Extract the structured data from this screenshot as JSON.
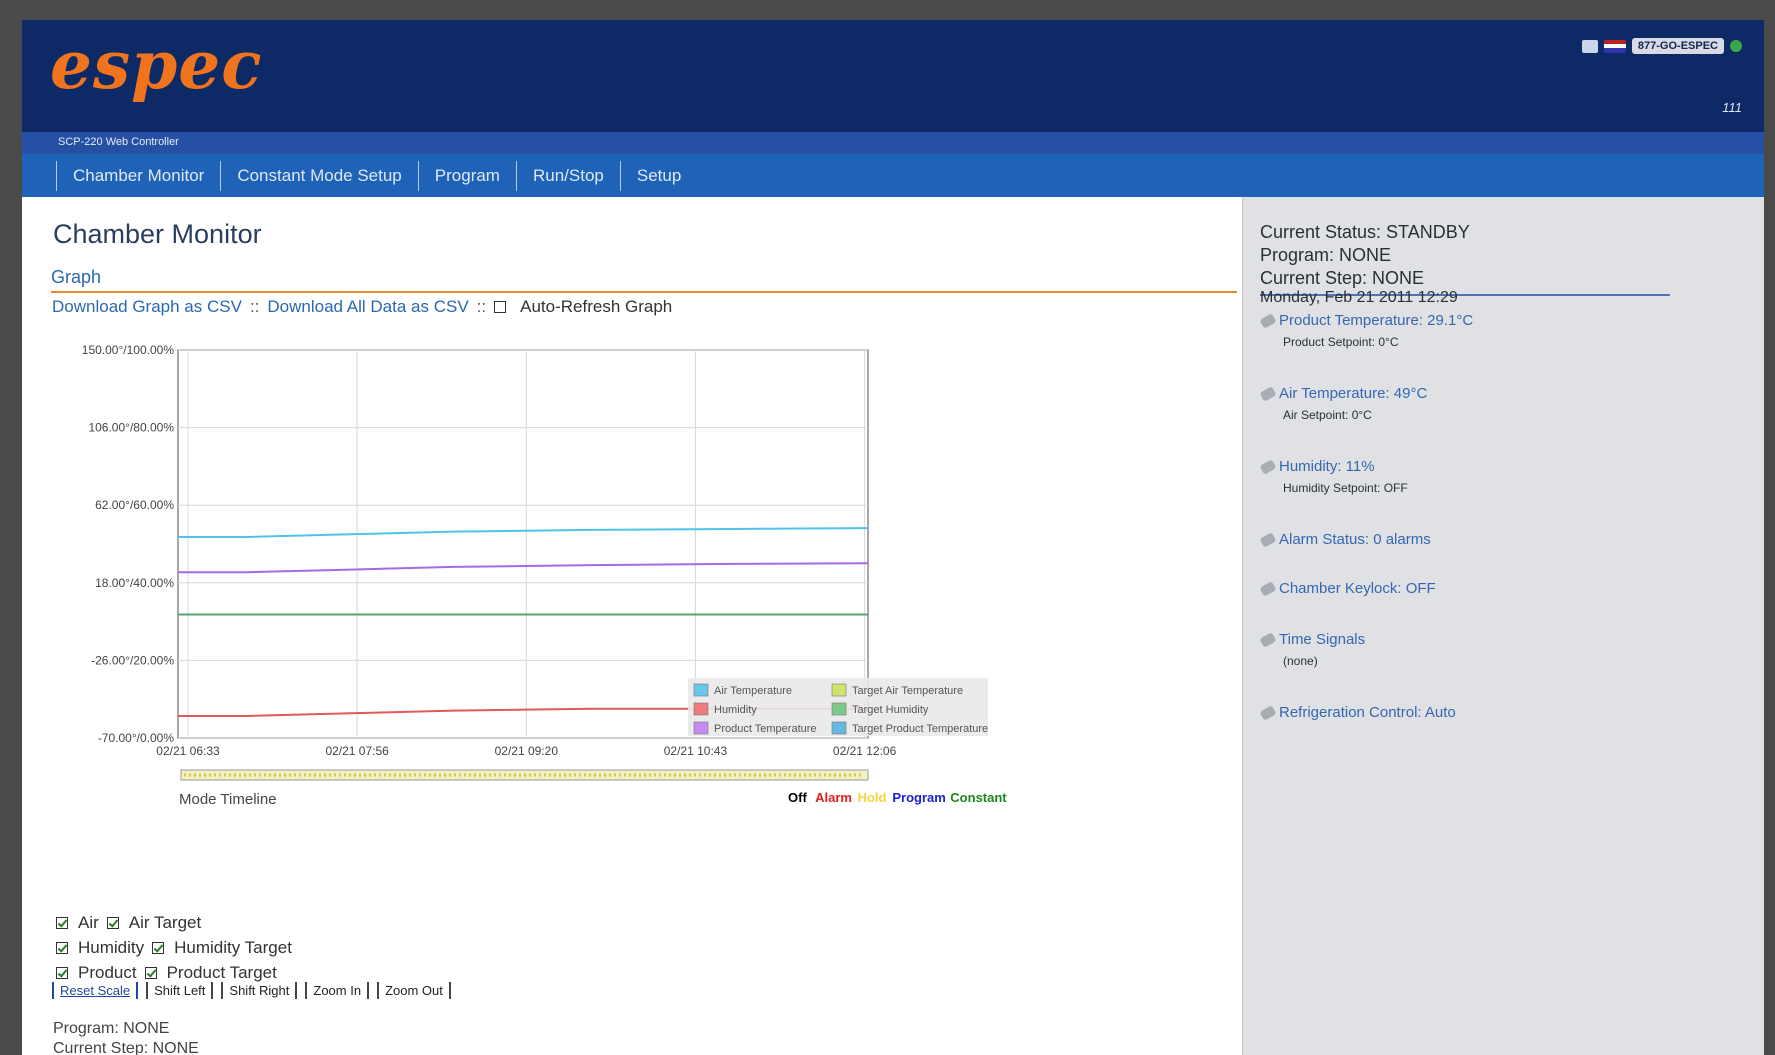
{
  "header": {
    "logo": "espec",
    "phone": "877-GO-ESPEC",
    "version": "111"
  },
  "subbar": {
    "product": "SCP-220 Web Controller"
  },
  "nav": [
    "Chamber Monitor",
    "Constant Mode Setup",
    "Program",
    "Run/Stop",
    "Setup"
  ],
  "main": {
    "title": "Chamber Monitor",
    "section": "Graph",
    "links": {
      "csv_graph": "Download Graph as CSV",
      "separator": "::",
      "csv_all": "Download All Data as CSV",
      "auto_refresh": "Auto-Refresh Graph"
    },
    "mode_timeline_label": "Mode Timeline",
    "mode_legend": [
      {
        "label": "Off",
        "color": "#000000"
      },
      {
        "label": "Alarm",
        "color": "#e11c1c"
      },
      {
        "label": "Hold",
        "color": "#f5d33c"
      },
      {
        "label": "Program",
        "color": "#1c22c8"
      },
      {
        "label": "Constant",
        "color": "#1a8a1a"
      }
    ],
    "checkbox_rows": [
      [
        {
          "label": "Air",
          "checked": true
        },
        {
          "label": "Air Target",
          "checked": true
        }
      ],
      [
        {
          "label": "Humidity",
          "checked": true
        },
        {
          "label": "Humidity Target",
          "checked": true
        }
      ],
      [
        {
          "label": "Product",
          "checked": true
        },
        {
          "label": "Product Target",
          "checked": true
        }
      ]
    ],
    "controls": [
      "Reset Scale",
      "Shift Left",
      "Shift Right",
      "Zoom In",
      "Zoom Out"
    ],
    "program_line": "Program: NONE",
    "step_line": "Current Step: NONE"
  },
  "sidebar": {
    "status": "Current Status: STANDBY",
    "program": "Program: NONE",
    "step": "Current Step: NONE",
    "date": "Monday, Feb 21 2011 12:29",
    "items": [
      {
        "label": "Product Temperature: 29.1°C",
        "sub": "Product Setpoint: 0°C"
      },
      {
        "label": "Air Temperature: 49°C",
        "sub": "Air Setpoint: 0°C"
      },
      {
        "label": "Humidity: 11%",
        "sub": "Humidity Setpoint: OFF"
      },
      {
        "label": "Alarm Status: 0 alarms",
        "sub": ""
      },
      {
        "label": "Chamber Keylock: OFF",
        "sub": ""
      },
      {
        "label": "Time Signals",
        "sub": "(none)"
      },
      {
        "label": "Refrigeration Control: Auto",
        "sub": ""
      }
    ]
  },
  "chart_data": {
    "type": "line",
    "ytick_labels": [
      "150.00°/100.00%",
      "106.00°/80.00%",
      "62.00°/60.00%",
      "18.00°/40.00%",
      "-26.00°/20.00%",
      "-70.00°/0.00%"
    ],
    "xtick_labels": [
      "02/21 06:33",
      "02/21 07:56",
      "02/21 09:20",
      "02/21 10:43",
      "02/21 12:06"
    ],
    "ylim": [
      -70,
      150
    ],
    "x": [
      0,
      0.1,
      0.25,
      0.4,
      0.6,
      0.8,
      1.0
    ],
    "series": [
      {
        "name": "Air Temperature",
        "color": "#4fc3e9",
        "values": [
          44,
          44,
          45.5,
          47,
          48,
          48.5,
          49
        ]
      },
      {
        "name": "Product Temperature",
        "color": "#a56ae6",
        "values": [
          24,
          24,
          25.5,
          27,
          28,
          28.7,
          29.1
        ]
      },
      {
        "name": "Humidity",
        "color": "#e05a5a",
        "values": [
          -57.5,
          -57.5,
          -56,
          -54.5,
          -53.4,
          -53.4,
          -53.4
        ]
      },
      {
        "name": "Target Humidity",
        "color": "#55a66e",
        "values": [
          0,
          0,
          0,
          0,
          0,
          0,
          0
        ]
      }
    ],
    "legend": [
      {
        "name": "Air Temperature",
        "color": "#66c9ec"
      },
      {
        "name": "Target Air Temperature",
        "color": "#cfe36d"
      },
      {
        "name": "Humidity",
        "color": "#ee7b7b"
      },
      {
        "name": "Target Humidity",
        "color": "#7dc98a"
      },
      {
        "name": "Product Temperature",
        "color": "#c48cf0"
      },
      {
        "name": "Target Product Temperature",
        "color": "#64b9e3"
      }
    ],
    "grid": true,
    "legend_position": "bottom-right"
  }
}
